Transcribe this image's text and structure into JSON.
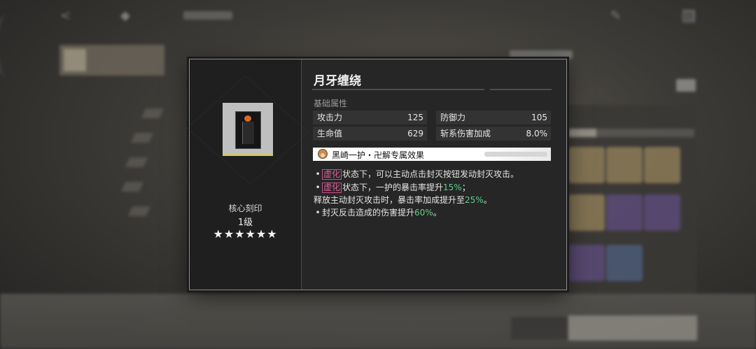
{
  "dialog": {
    "title": "月牙缠绕",
    "imprint": {
      "label": "核心刻印",
      "level": "1级",
      "stars": "★★★★★★"
    },
    "base_section_label": "基础属性",
    "stats": [
      {
        "label": "攻击力",
        "value": "125"
      },
      {
        "label": "防御力",
        "value": "105"
      },
      {
        "label": "生命值",
        "value": "629"
      },
      {
        "label": "斩系伤害加成",
        "value": "8.0%"
      }
    ],
    "effect_title": "黑崎一护・卍解专属效果",
    "lines": [
      {
        "bullet": "•",
        "tag": "虚化",
        "text": "状态下，可以主动点击封灭按钮发动封灭攻击。"
      },
      {
        "bullet": "•",
        "tag": "虚化",
        "text": "状态下，一护的暴击率提升",
        "num": "15%",
        "tail": "；"
      },
      {
        "text": "释放主动封灭攻击时，暴击率加成提升至",
        "num": "25%",
        "tail": "。"
      },
      {
        "bullet": "•",
        "text": "封灭反击造成的伤害提升",
        "num": "60%",
        "tail": "。"
      }
    ]
  },
  "colors": {
    "accent_green": "#5fcf8c",
    "tag_pink": "#e0609a",
    "card_border": "#d8c36a"
  },
  "icons": [
    "share-icon",
    "diamond-icon",
    "settings-icon",
    "grid-icon"
  ]
}
